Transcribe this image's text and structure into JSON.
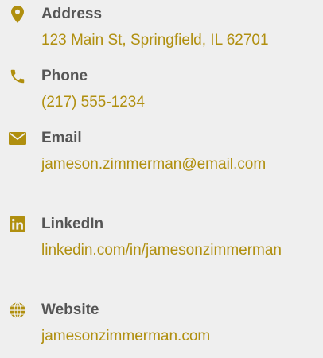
{
  "accent_color": "#b08f0f",
  "label_color": "#555555",
  "contacts": [
    {
      "icon": "map-pin-icon",
      "label": "Address",
      "value": "123 Main St, Springfield, IL 62701"
    },
    {
      "icon": "phone-icon",
      "label": "Phone",
      "value": "(217) 555-1234"
    },
    {
      "icon": "envelope-icon",
      "label": "Email",
      "value": "jameson.zimmerman@email.com"
    },
    {
      "icon": "linkedin-icon",
      "label": "LinkedIn",
      "value": "linkedin.com/in/jamesonzimmerman"
    },
    {
      "icon": "globe-icon",
      "label": "Website",
      "value": "jamesonzimmerman.com"
    }
  ]
}
